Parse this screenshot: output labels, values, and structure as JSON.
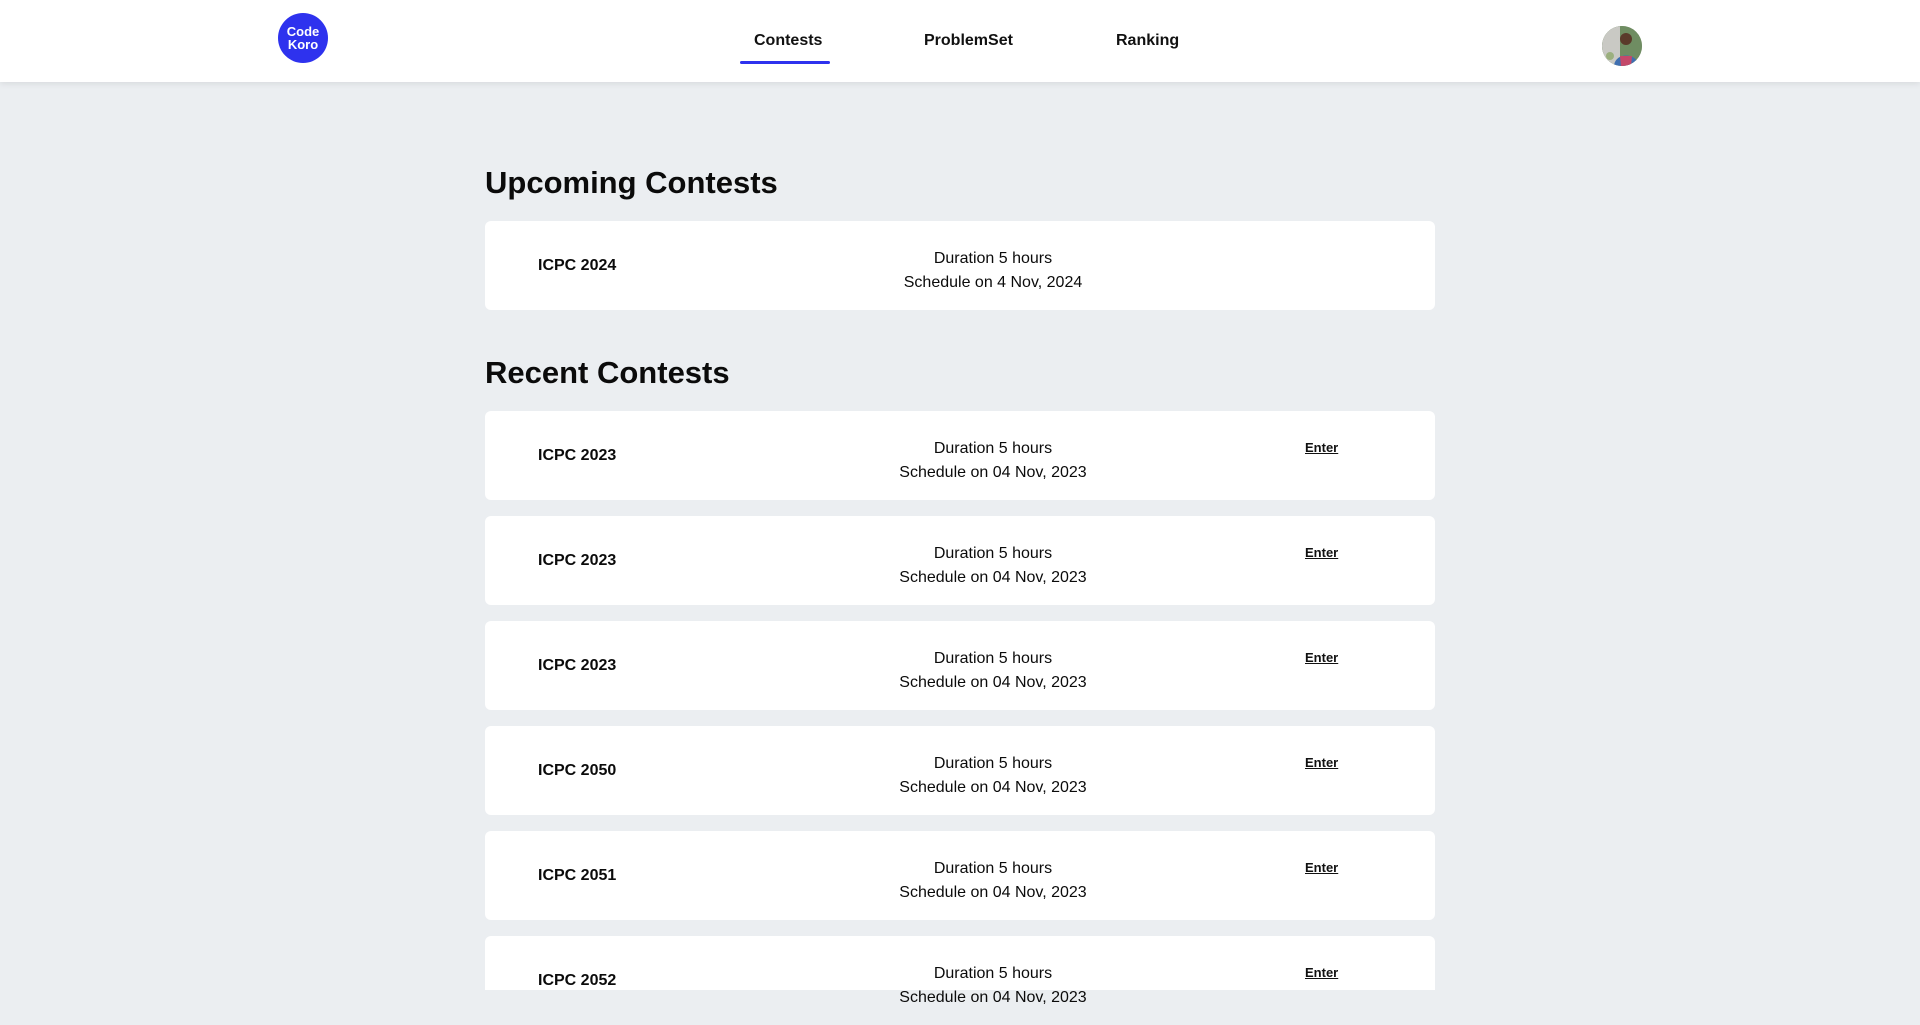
{
  "brand": {
    "logo_line1": "Code",
    "logo_line2": "Koro",
    "accent": "#2e32ee"
  },
  "nav": {
    "items": [
      {
        "label": "Contests",
        "active": true
      },
      {
        "label": "ProblemSet",
        "active": false
      },
      {
        "label": "Ranking",
        "active": false
      }
    ]
  },
  "user": {
    "avatar_icon": "user-avatar-photo"
  },
  "upcoming": {
    "title": "Upcoming Contests",
    "contests": [
      {
        "name": "ICPC 2024",
        "duration": "Duration 5 hours",
        "schedule": "Schedule on 4 Nov, 2024"
      }
    ]
  },
  "recent": {
    "title": "Recent Contests",
    "enter_label": "Enter",
    "contests": [
      {
        "name": "ICPC 2023",
        "duration": "Duration 5 hours",
        "schedule": "Schedule on 04 Nov, 2023"
      },
      {
        "name": "ICPC 2023",
        "duration": "Duration 5 hours",
        "schedule": "Schedule on 04 Nov, 2023"
      },
      {
        "name": "ICPC 2023",
        "duration": "Duration 5 hours",
        "schedule": "Schedule on 04 Nov, 2023"
      },
      {
        "name": "ICPC 2050",
        "duration": "Duration 5 hours",
        "schedule": "Schedule on 04 Nov, 2023"
      },
      {
        "name": "ICPC 2051",
        "duration": "Duration 5 hours",
        "schedule": "Schedule on 04 Nov, 2023"
      },
      {
        "name": "ICPC 2052",
        "duration": "Duration 5 hours",
        "schedule": "Schedule on 04 Nov, 2023"
      }
    ]
  }
}
